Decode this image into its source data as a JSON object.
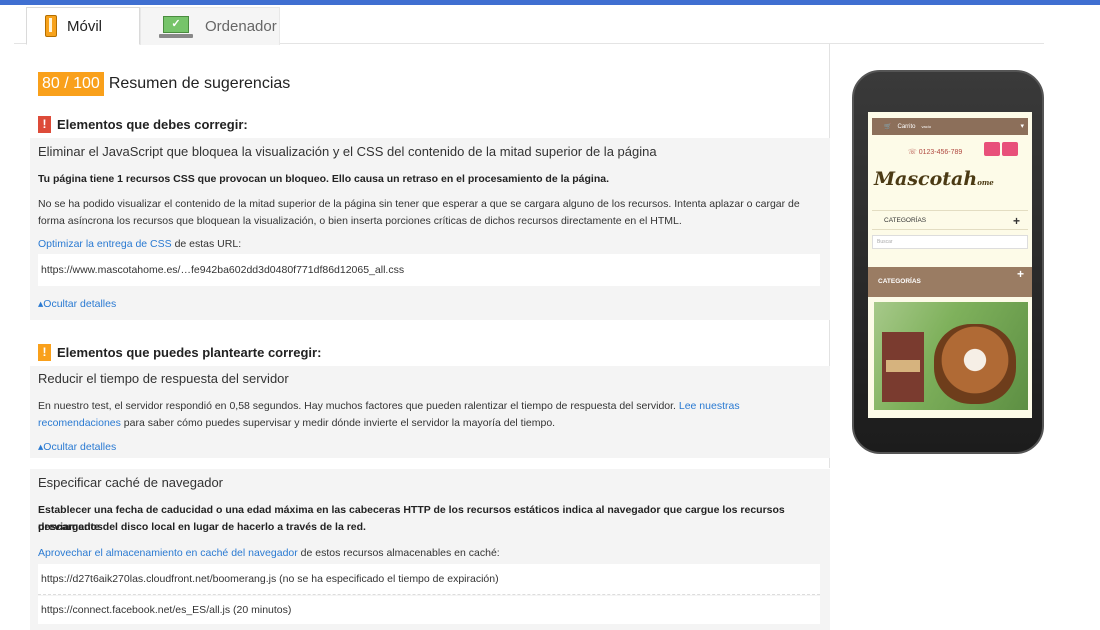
{
  "tabs": [
    {
      "label": "Móvil",
      "icon": "mobile-phone-icon",
      "active": true
    },
    {
      "label": "Ordenador",
      "icon": "laptop-icon",
      "active": false
    }
  ],
  "score": {
    "value": "80 / 100",
    "title": "Resumen de sugerencias",
    "color": "#f9a01b"
  },
  "must_fix": {
    "heading": "Elementos que debes corregir:",
    "rule_title": "Eliminar el JavaScript que bloquea la visualización y el CSS del contenido de la mitad superior de la página",
    "summary": "Tu página tiene 1 recursos CSS que provocan un bloqueo. Ello causa un retraso en el procesamiento de la página.",
    "desc_line1": "No se ha podido visualizar el contenido de la mitad superior de la página sin tener que esperar a que se cargara alguno de los recursos. Intenta aplazar o cargar de",
    "desc_line2": "forma asíncrona los recursos que bloquean la visualización, o bien inserta porciones críticas de dichos recursos directamente en el HTML.",
    "link_text": "Optimizar la entrega de CSS",
    "link_suffix": " de estas URL:",
    "url": "https://www.mascotahome.es/…fe942ba602dd3d0480f771df86d12065_all.css",
    "hide_details": "Ocultar detalles"
  },
  "consider_fix": {
    "heading": "Elementos que puedes plantearte corregir:",
    "rule_title": "Reducir el tiempo de respuesta del servidor",
    "desc_prefix": "En nuestro test, el servidor respondió en 0,58 segundos. Hay muchos factores que pueden ralentizar el tiempo de respuesta del servidor. ",
    "desc_link1": "Lee nuestras",
    "desc_link2": "recomendaciones",
    "desc_suffix": " para saber cómo puedes supervisar y medir dónde invierte el servidor la mayoría del tiempo.",
    "hide_details": "Ocultar detalles"
  },
  "cache": {
    "rule_title": "Especificar caché de navegador",
    "summary_line1": "Establecer una fecha de caducidad o una edad máxima en las cabeceras HTTP de los recursos estáticos indica al navegador que cargue los recursos descargados",
    "summary_line2": "previamente del disco local en lugar de hacerlo a través de la red.",
    "link_text": "Aprovechar el almacenamiento en caché del navegador",
    "link_suffix": " de estos recursos almacenables en caché:",
    "urls": [
      "https://d27t6aik270las.cloudfront.net/boomerang.js (no se ha especificado el tiempo de expiración)",
      "https://connect.facebook.net/es_ES/all.js (20 minutos)"
    ]
  },
  "preview": {
    "cart_label": "Carrito",
    "cart_state": "vacío",
    "phone": "0123-456-789",
    "logo_main": "Mascota",
    "logo_end": "ome",
    "logo_h": "h",
    "categories": "CATEGORÍAS",
    "search_placeholder": "Buscar",
    "categories2": "CATEGORÍAS",
    "plus": "+"
  }
}
